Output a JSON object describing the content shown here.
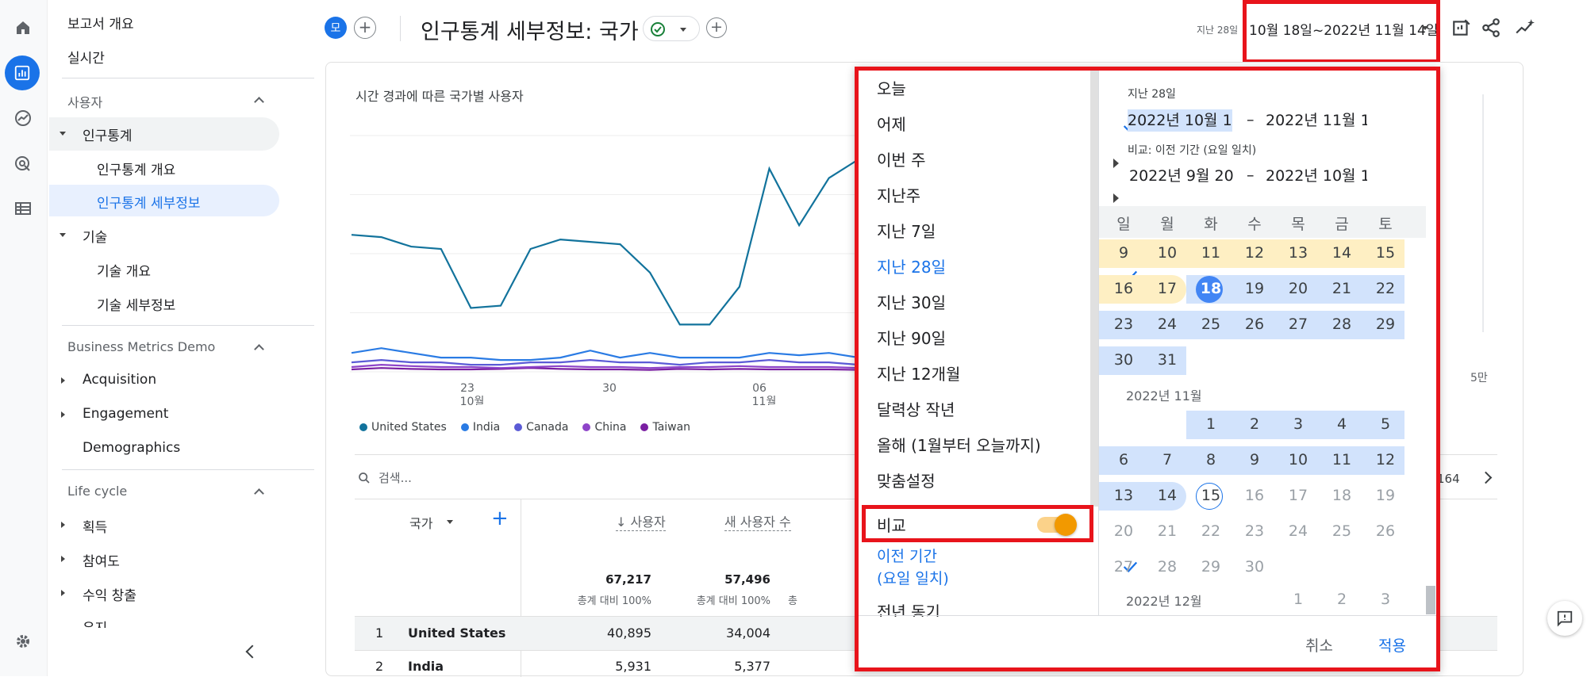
{
  "nav": {
    "items": [
      "보고서 개요",
      "실시간"
    ],
    "sections": [
      {
        "label": "사용자",
        "groups": [
          {
            "label": "인구통계",
            "children": [
              "인구통계 개요",
              "인구통계 세부정보"
            ]
          },
          {
            "label": "기술",
            "children": [
              "기술 개요",
              "기술 세부정보"
            ]
          }
        ]
      },
      {
        "label": "Business Metrics Demo",
        "items": [
          "Acquisition",
          "Engagement",
          "Demographics"
        ]
      },
      {
        "label": "Life cycle",
        "items": [
          "획득",
          "참여도",
          "수익 창출",
          "유지"
        ]
      }
    ]
  },
  "header": {
    "avatar_letter": "모",
    "title": "인구통계 세부정보: 국가",
    "range_prefix": "지난 28일",
    "range": "10월 18일~2022년 11월 14일"
  },
  "chart": {
    "title": "시간 경과에 따른 국가별 사용자",
    "x_ticks": [
      {
        "day": "23",
        "month": "10월"
      },
      {
        "day": "30",
        "month": ""
      },
      {
        "day": "06",
        "month": "11월"
      }
    ],
    "right_label": "5만",
    "legend": [
      {
        "name": "United States",
        "color": "#12739c"
      },
      {
        "name": "India",
        "color": "#2a7be4"
      },
      {
        "name": "Canada",
        "color": "#5b5bd6"
      },
      {
        "name": "China",
        "color": "#8e44c9"
      },
      {
        "name": "Taiwan",
        "color": "#7a1fa2"
      }
    ]
  },
  "chart_data": {
    "type": "line",
    "title": "시간 경과에 따른 국가별 사용자",
    "x_tick_labels": [
      "23 10월",
      "30",
      "06 11월"
    ],
    "series": [
      {
        "name": "United States",
        "values": [
          2900,
          2850,
          2650,
          2600,
          1350,
          1400,
          2600,
          2800,
          2750,
          2700,
          2100,
          1000,
          1000,
          1800,
          4300,
          3100,
          4100,
          4500,
          1300,
          1400,
          3250,
          3800,
          3300,
          2800
        ]
      },
      {
        "name": "India",
        "values": [
          400,
          500,
          400,
          300,
          300,
          250,
          250,
          300,
          450,
          300,
          400,
          300,
          300,
          300,
          400,
          350,
          400,
          300,
          350,
          400,
          450,
          350,
          400,
          400
        ]
      },
      {
        "name": "Canada",
        "values": [
          200,
          250,
          200,
          200,
          150,
          150,
          200,
          200,
          250,
          200,
          200,
          150,
          200,
          200,
          250,
          200,
          200,
          150,
          200,
          250,
          200,
          200,
          200,
          250
        ]
      },
      {
        "name": "China",
        "values": [
          100,
          150,
          120,
          100,
          100,
          80,
          100,
          120,
          100,
          100,
          80,
          100,
          100,
          120,
          100,
          100,
          100,
          80,
          100,
          120,
          100,
          100,
          100,
          100
        ]
      },
      {
        "name": "Taiwan",
        "values": [
          50,
          80,
          60,
          50,
          50,
          60,
          80,
          60,
          50,
          50,
          40,
          60,
          50,
          60,
          50,
          50,
          50,
          40,
          60,
          50,
          60,
          50,
          60,
          50
        ]
      }
    ]
  },
  "table": {
    "search_placeholder": "검색...",
    "page_info_partial": "164",
    "dimension_header": "국가",
    "columns": [
      {
        "label": "사용자",
        "total": "67,217",
        "sub": "총계 대비 100%"
      },
      {
        "label": "새 사용자 수",
        "total": "57,496",
        "sub": "총계 대비 100%"
      }
    ],
    "partial_col_sub": "총",
    "rows": [
      {
        "rank": "1",
        "country": "United States",
        "users": "40,895",
        "new_users": "34,004"
      },
      {
        "rank": "2",
        "country": "India",
        "users": "5,931",
        "new_users": "5,377"
      }
    ]
  },
  "picker": {
    "presets": [
      "오늘",
      "어제",
      "이번 주",
      "지난주",
      "지난 7일",
      "지난 28일",
      "지난 30일",
      "지난 90일",
      "지난 12개월",
      "달력상 작년",
      "올해 (1월부터 오늘까지)",
      "맞춤설정"
    ],
    "selected_preset": "지난 28일",
    "compare_label": "비교",
    "compare_on": true,
    "compare_options": [
      "이전 기간\n(요일 일치)",
      "전년 동기"
    ],
    "range_label": "지난 28일",
    "start_date": "2022년 10월 18",
    "end_date": "2022년 11월 14",
    "dash": "–",
    "compare_label_full": "비교: 이전 기간 (요일 일치)",
    "compare_start": "2022년 9월 20",
    "compare_end": "2022년 10월 17",
    "weekdays": [
      "일",
      "월",
      "화",
      "수",
      "목",
      "금",
      "토"
    ],
    "oct_rows": [
      [
        "9",
        "10",
        "11",
        "12",
        "13",
        "14",
        "15"
      ],
      [
        "16",
        "17",
        "18",
        "19",
        "20",
        "21",
        "22"
      ],
      [
        "23",
        "24",
        "25",
        "26",
        "27",
        "28",
        "29"
      ],
      [
        "30",
        "31"
      ]
    ],
    "nov_label": "2022년 11월",
    "nov_rows": [
      [
        "",
        "",
        "1",
        "2",
        "3",
        "4",
        "5"
      ],
      [
        "6",
        "7",
        "8",
        "9",
        "10",
        "11",
        "12"
      ],
      [
        "13",
        "14",
        "15",
        "16",
        "17",
        "18",
        "19"
      ],
      [
        "20",
        "21",
        "22",
        "23",
        "24",
        "25",
        "26"
      ],
      [
        "27",
        "28",
        "29",
        "30"
      ]
    ],
    "dec_label": "2022년 12월",
    "dec_partial": [
      "1",
      "2",
      "3"
    ],
    "cancel": "취소",
    "apply": "적용"
  },
  "colors": {
    "accent": "#1a73e8",
    "highlight": "#d2e3fc",
    "compare": "#feefc3",
    "red": "#e8141b",
    "toggle": "#f29900"
  }
}
